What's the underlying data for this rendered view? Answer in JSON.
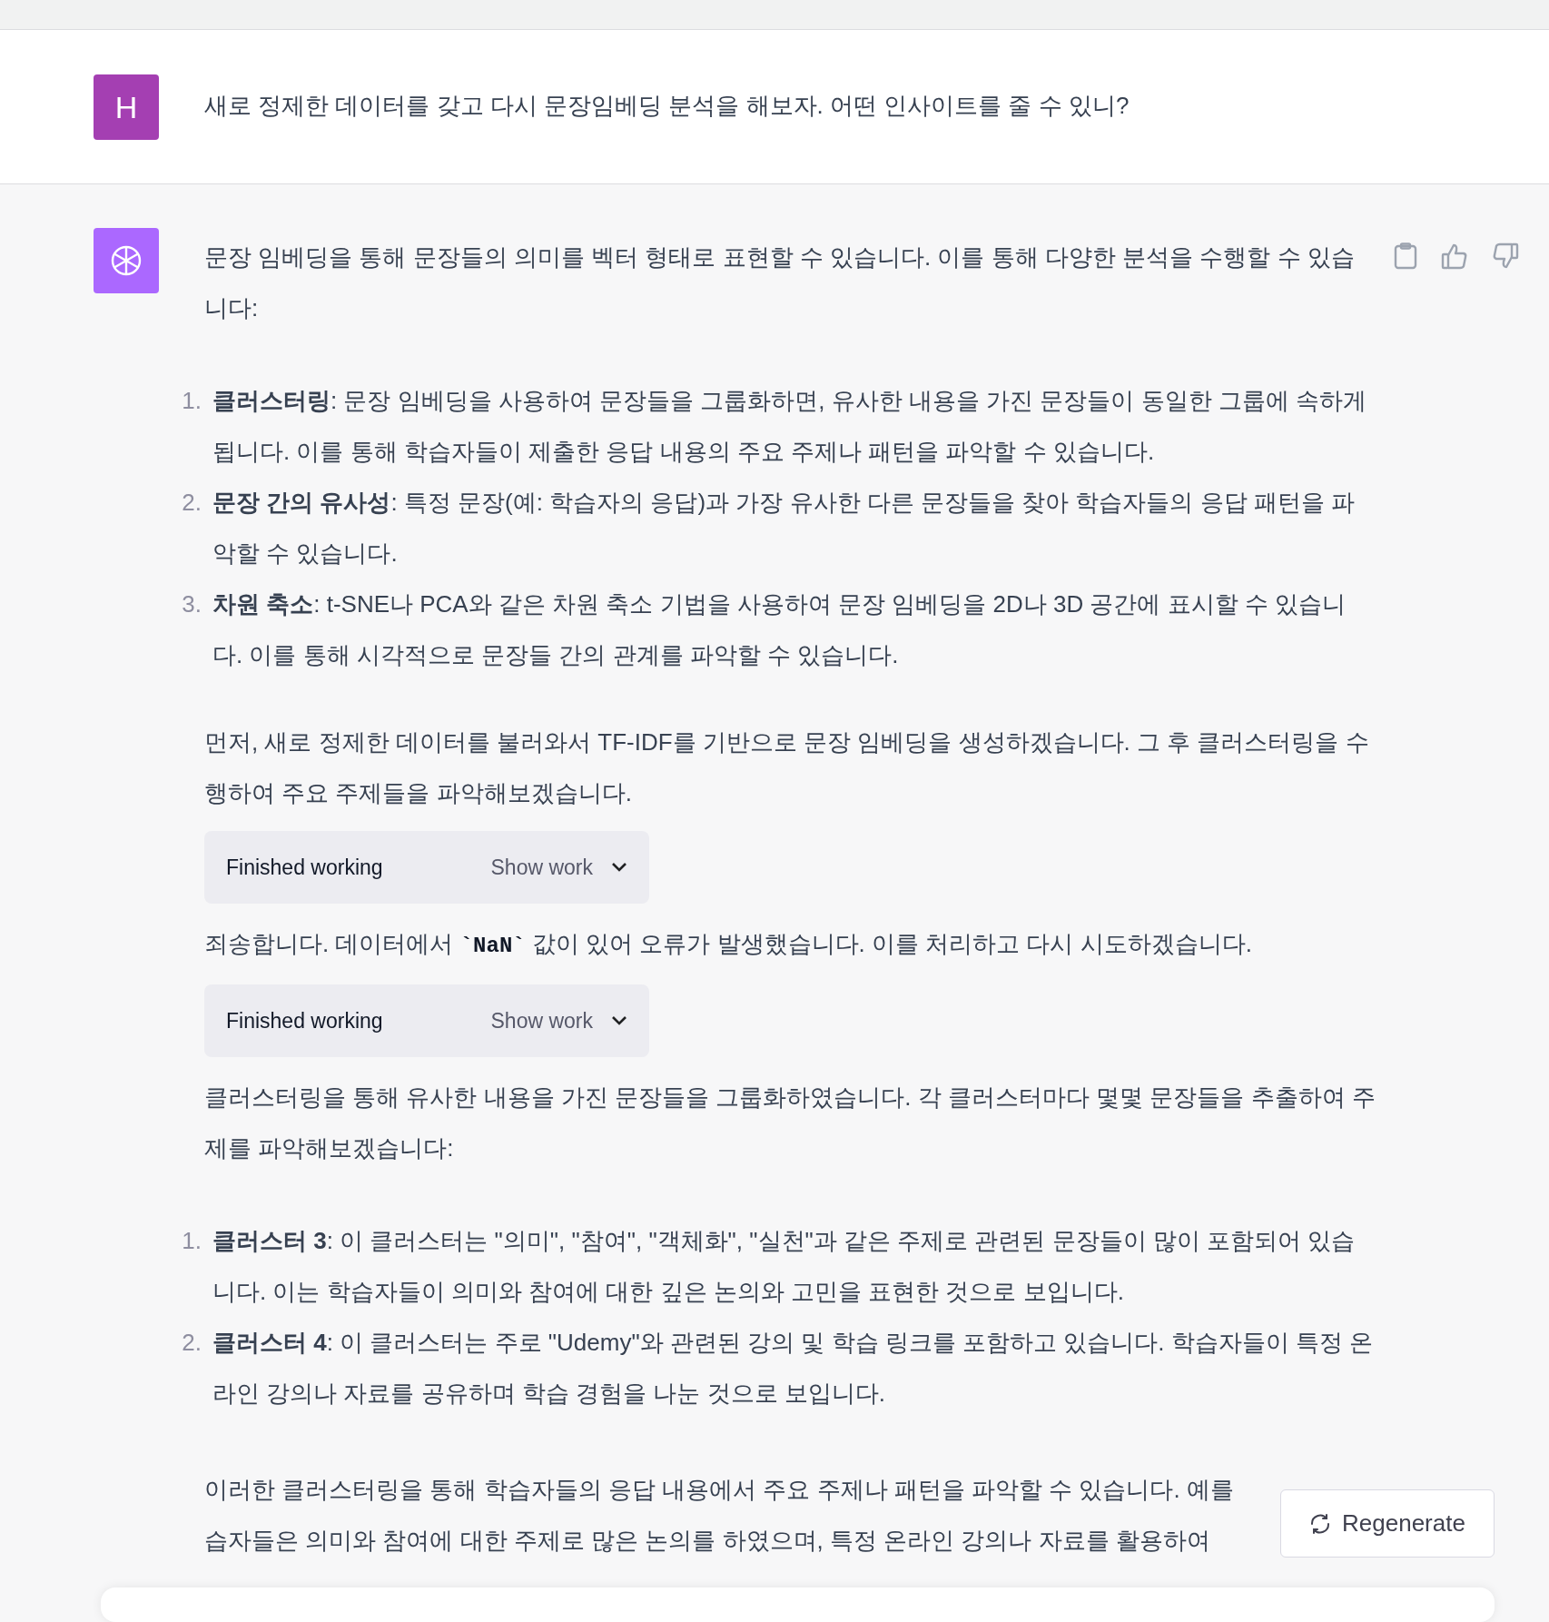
{
  "user_message": {
    "avatar_letter": "H",
    "text": "새로 정제한 데이터를 갖고 다시 문장임베딩 분석을 해보자. 어떤 인사이트를 줄 수 있니?"
  },
  "assistant_message": {
    "blocks": [
      {
        "kind": "paragraph",
        "parts": [
          {
            "kind": "text",
            "text": "문장 임베딩을 통해 문장들의 의미를 벡터 형태로 표현할 수 있습니다. 이를 통해 다양한 분석을 수행할 수 있습니다:"
          }
        ]
      },
      {
        "kind": "list",
        "items": [
          {
            "number": "1.",
            "text": "**클러스터링**: 문장 임베딩을 사용하여 문장들을 그룹화하면, 유사한 내용을 가진 문장들이 동일한 그룹에 속하게 됩니다. 이를 통해 학습자들이 제출한 응답 내용의 주요 주제나 패턴을 파악할 수 있습니다."
          },
          {
            "number": "2.",
            "text": "**문장 간의 유사성**: 특정 문장(예: 학습자의 응답)과 가장 유사한 다른 문장들을 찾아 학습자들의 응답 패턴을 파악할 수 있습니다."
          },
          {
            "number": "3.",
            "text": "**차원 축소**: t-SNE나 PCA와 같은 차원 축소 기법을 사용하여 문장 임베딩을 2D나 3D 공간에 표시할 수 있습니다. 이를 통해 시각적으로 문장들 간의 관계를 파악할 수 있습니다."
          }
        ]
      },
      {
        "kind": "paragraph",
        "parts": [
          {
            "kind": "text",
            "text": "먼저, 새로 정제한 데이터를 불러와서 TF-IDF를 기반으로 문장 임베딩을 생성하겠습니다. 그 후 클러스터링을 수행하여 주요 주제들을 파악해보겠습니다."
          }
        ]
      },
      {
        "kind": "work",
        "status": "Finished working",
        "toggle": "Show work"
      },
      {
        "kind": "paragraph",
        "parts": [
          {
            "kind": "text",
            "text": "죄송합니다. 데이터에서 "
          },
          {
            "kind": "code",
            "text": "`NaN`"
          },
          {
            "kind": "text",
            "text": " 값이 있어 오류가 발생했습니다. 이를 처리하고 다시 시도하겠습니다."
          }
        ]
      },
      {
        "kind": "work",
        "status": "Finished working",
        "toggle": "Show work"
      },
      {
        "kind": "paragraph",
        "parts": [
          {
            "kind": "text",
            "text": "클러스터링을 통해 유사한 내용을 가진 문장들을 그룹화하였습니다. 각 클러스터마다 몇몇 문장들을 추출하여 주제를 파악해보겠습니다:"
          }
        ]
      },
      {
        "kind": "list",
        "items": [
          {
            "number": "1.",
            "text": "**클러스터 3**: 이 클러스터는 \"의미\", \"참여\", \"객체화\", \"실천\"과 같은 주제로 관련된 문장들이 많이 포함되어 있습니다. 이는 학습자들이 의미와 참여에 대한 깊은 논의와 고민을 표현한 것으로 보입니다."
          },
          {
            "number": "2.",
            "text": "**클러스터 4**: 이 클러스터는 주로 \"Udemy\"와 관련된 강의 및 학습 링크를 포함하고 있습니다. 학습자들이 특정 온라인 강의나 자료를 공유하며 학습 경험을 나눈 것으로 보입니다."
          }
        ]
      },
      {
        "kind": "cut_paragraph",
        "lines": [
          "이러한 클러스터링을 통해 학습자들의 응답 내용에서 주요 주제나 패턴을 파악할 수 있습니다. 예를",
          "습자들은 의미와 참여에 대한 주제로 많은 논의를 하였으며, 특정 온라인 강의나 자료를 활용하여"
        ]
      }
    ]
  },
  "regenerate_button": {
    "label": "Regenerate"
  }
}
